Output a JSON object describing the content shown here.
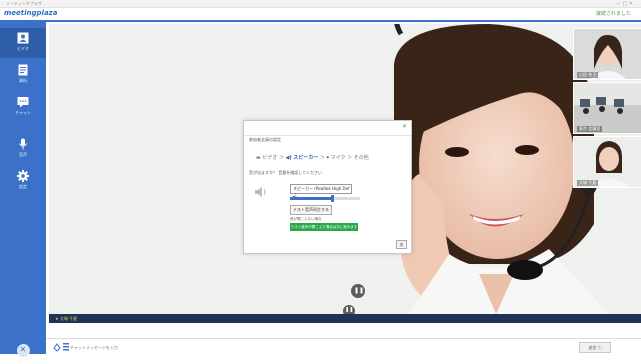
{
  "window": {
    "title": "ミーティングプラザ",
    "controls": "－ □ ✕"
  },
  "app": {
    "logo": "meetingplaza",
    "status": "接続されました"
  },
  "sidebar": {
    "items": [
      {
        "label": "ビデオ",
        "icon": "person-icon"
      },
      {
        "label": "資料",
        "icon": "document-icon"
      },
      {
        "label": "チャット",
        "icon": "chat-icon"
      },
      {
        "label": "音声",
        "icon": "microphone-icon"
      },
      {
        "label": "設定",
        "icon": "gear-icon"
      }
    ],
    "exit_label": "終了"
  },
  "main": {
    "speaker_name": "大城 千夏"
  },
  "thumbnails": [
    {
      "name": "山田 花子"
    },
    {
      "name": "東京 会議室"
    },
    {
      "name": "大城 千夏"
    }
  ],
  "dialog": {
    "title": "参加者全員の設定",
    "steps": [
      "ビデオ",
      "スピーカー",
      "マイク",
      "その他"
    ],
    "current_step": "スピーカー",
    "check_line": "音が出ますか？ 音量を確認してください",
    "device": "スピーカー (Realtek High Def ▾)",
    "volume": 0.6,
    "test_button": "テスト音声再生する",
    "hint": "音が聞こえない場合",
    "green_button": "テスト音声が聞こえた場合は次に進みます",
    "ok_button": "次"
  },
  "chat": {
    "placeholder": "チャットメッセージを入力",
    "send_label": "送信 ⓒ"
  },
  "colors": {
    "accent": "#3b71c8",
    "success": "#2aa84a"
  }
}
